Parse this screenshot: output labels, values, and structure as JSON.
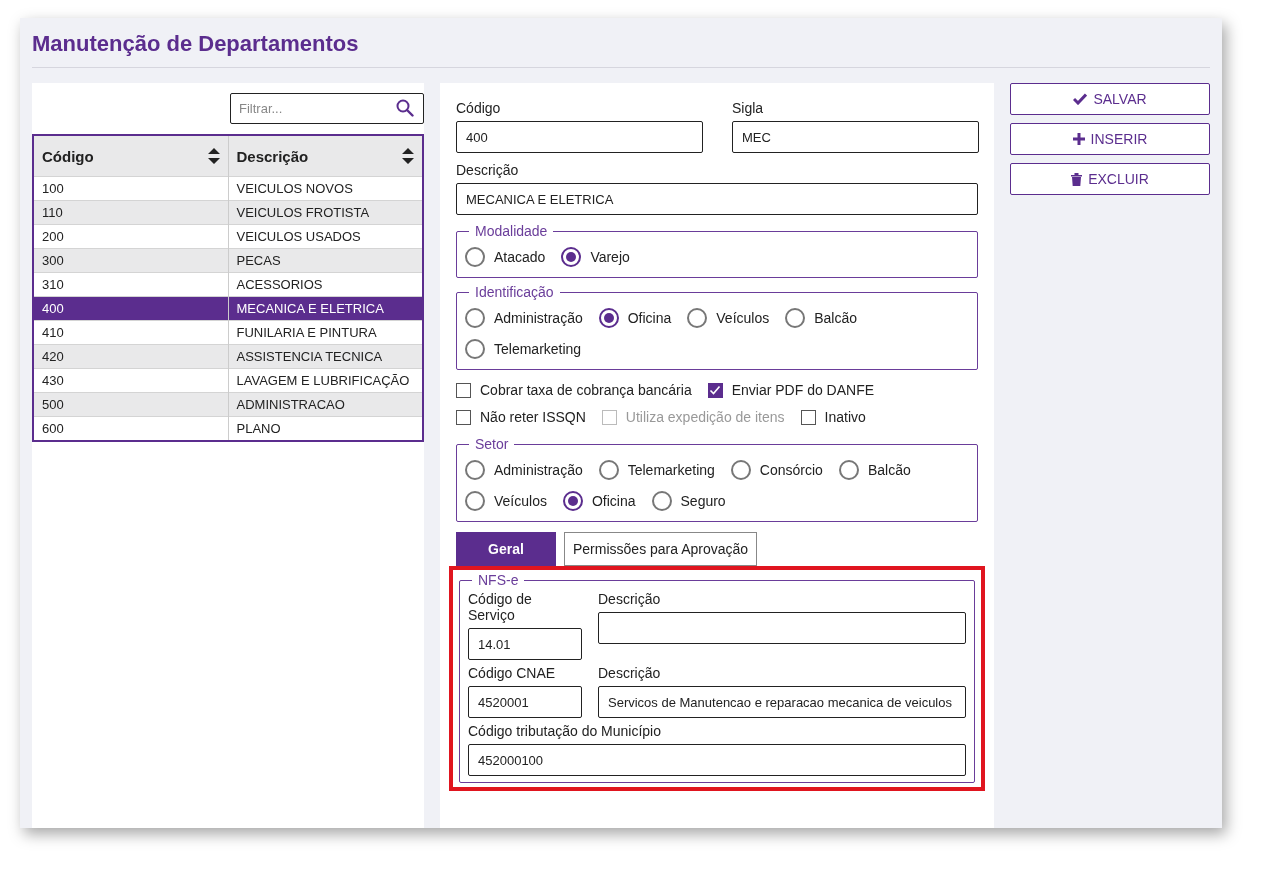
{
  "title": "Manutenção de Departamentos",
  "filter": {
    "placeholder": "Filtrar..."
  },
  "table": {
    "columns": [
      "Código",
      "Descrição"
    ],
    "rows": [
      {
        "cells": [
          "100",
          "VEICULOS NOVOS"
        ],
        "selected": false
      },
      {
        "cells": [
          "110",
          "VEICULOS FROTISTA"
        ],
        "selected": false
      },
      {
        "cells": [
          "200",
          "VEICULOS USADOS"
        ],
        "selected": false
      },
      {
        "cells": [
          "300",
          "PECAS"
        ],
        "selected": false
      },
      {
        "cells": [
          "310",
          "ACESSORIOS"
        ],
        "selected": false
      },
      {
        "cells": [
          "400",
          "MECANICA E ELETRICA"
        ],
        "selected": true
      },
      {
        "cells": [
          "410",
          "FUNILARIA E PINTURA"
        ],
        "selected": false
      },
      {
        "cells": [
          "420",
          "ASSISTENCIA TECNICA"
        ],
        "selected": false
      },
      {
        "cells": [
          "430",
          "LAVAGEM E LUBRIFICAÇÃO"
        ],
        "selected": false
      },
      {
        "cells": [
          "500",
          "ADMINISTRACAO"
        ],
        "selected": false
      },
      {
        "cells": [
          "600",
          "PLANO"
        ],
        "selected": false
      }
    ]
  },
  "form": {
    "codigo": {
      "label": "Código",
      "value": "400"
    },
    "sigla": {
      "label": "Sigla",
      "value": "MEC"
    },
    "descricao": {
      "label": "Descrição",
      "value": "MECANICA E ELETRICA"
    }
  },
  "groups": [
    {
      "legend": "Modalidade",
      "options": [
        {
          "label": "Atacado",
          "selected": false
        },
        {
          "label": "Varejo",
          "selected": true
        }
      ]
    },
    {
      "legend": "Identificação",
      "options": [
        {
          "label": "Administração",
          "selected": false
        },
        {
          "label": "Oficina",
          "selected": true
        },
        {
          "label": "Veículos",
          "selected": false
        },
        {
          "label": "Balcão",
          "selected": false
        },
        {
          "label": "Telemarketing",
          "selected": false
        }
      ]
    }
  ],
  "checkbox_rows": [
    [
      {
        "label": "Cobrar taxa de cobrança bancária",
        "checked": false,
        "disabled": false
      },
      {
        "label": "Enviar PDF do DANFE",
        "checked": true,
        "disabled": false
      }
    ],
    [
      {
        "label": "Não reter ISSQN",
        "checked": false,
        "disabled": false
      },
      {
        "label": "Utiliza expedição de itens",
        "checked": false,
        "disabled": true
      },
      {
        "label": "Inativo",
        "checked": false,
        "disabled": false
      }
    ]
  ],
  "setor": {
    "legend": "Setor",
    "options": [
      {
        "label": "Administração",
        "selected": false
      },
      {
        "label": "Telemarketing",
        "selected": false
      },
      {
        "label": "Consórcio",
        "selected": false
      },
      {
        "label": "Balcão",
        "selected": false
      },
      {
        "label": "Veículos",
        "selected": false
      },
      {
        "label": "Oficina",
        "selected": true
      },
      {
        "label": "Seguro",
        "selected": false
      }
    ]
  },
  "tabs": [
    {
      "label": "Geral",
      "selected": true
    },
    {
      "label": "Permissões para Aprovação",
      "selected": false
    }
  ],
  "nfse": {
    "legend": "NFS-e",
    "servico": {
      "label": "Código de Serviço",
      "value": "14.01"
    },
    "servico_descricao": {
      "label": "Descrição"
    },
    "cnae": {
      "label": "Código CNAE",
      "value": "4520001"
    },
    "cnae_descricao": {
      "label": "Descrição",
      "value": "Servicos de Manutencao e reparacao mecanica de veiculos"
    },
    "tributacao": {
      "label": "Código tributação do Município",
      "value": "452000100"
    }
  },
  "buttons": [
    {
      "label": "SALVAR",
      "kind": "check"
    },
    {
      "label": "INSERIR",
      "kind": "plus"
    },
    {
      "label": "EXCLUIR",
      "kind": "trash"
    }
  ]
}
